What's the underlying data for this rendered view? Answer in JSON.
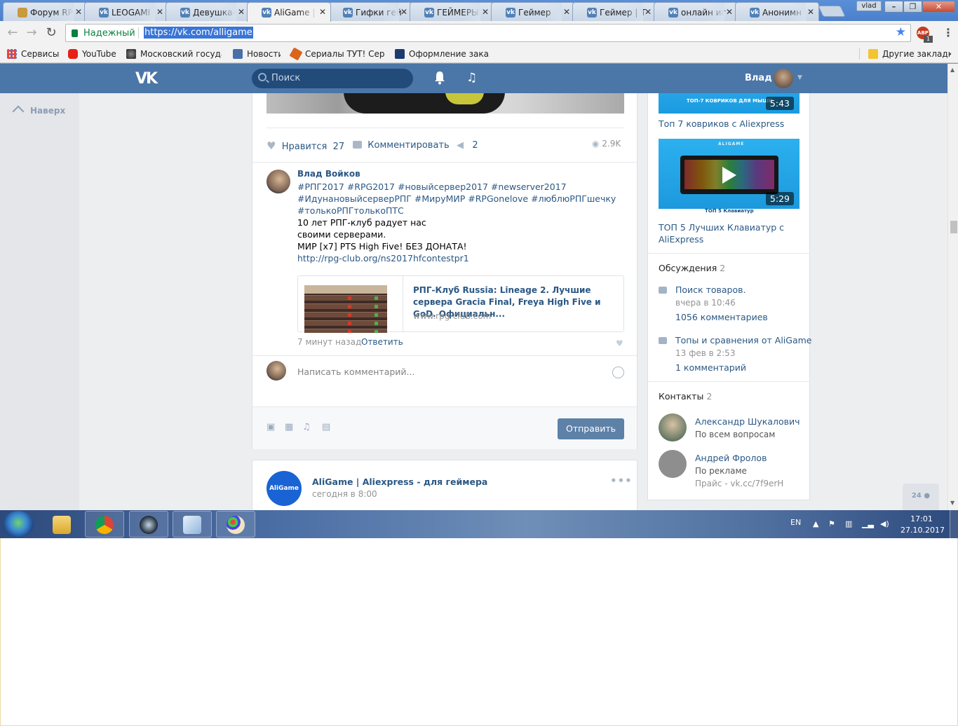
{
  "browser": {
    "tabs": [
      {
        "title": "Форум RP",
        "fav": "coat-of-arms-icon"
      },
      {
        "title": "LEOGAMI",
        "fav": "vk-icon"
      },
      {
        "title": "Девушка-",
        "fav": "vk-icon"
      },
      {
        "title": "AliGame |",
        "fav": "vk-icon",
        "active": true
      },
      {
        "title": "Гифки гей",
        "fav": "vk-icon"
      },
      {
        "title": "ГЕЙМЕРЫ",
        "fav": "vk-icon"
      },
      {
        "title": "Геймер",
        "fav": "vk-icon"
      },
      {
        "title": "Геймер | Т",
        "fav": "vk-icon"
      },
      {
        "title": "онлайн иг",
        "fav": "vk-icon"
      },
      {
        "title": "Анонимн",
        "fav": "vk-icon"
      }
    ],
    "profile_badge": "vlad",
    "secure_label": "Надежный",
    "url": "https://vk.com/alligame",
    "adblock_badge": "ABP",
    "adblock_count": "1",
    "bookmarks": [
      {
        "label": "Сервисы",
        "icon": "apps-grid-icon",
        "color": "#e8453c"
      },
      {
        "label": "YouTube",
        "icon": "youtube-icon",
        "color": "#e62117"
      },
      {
        "label": "Московский государ",
        "icon": "emblem-icon",
        "color": "#444444"
      },
      {
        "label": "Новости",
        "icon": "news-icon",
        "color": "#4a6ea9"
      },
      {
        "label": "Сериалы ТУТ! Сериа",
        "icon": "serials-icon",
        "color": "#d9641a"
      },
      {
        "label": "Оформление заказа",
        "icon": "sp-icon",
        "color": "#1c3a6e"
      },
      {
        "label": "Другие закладки",
        "icon": "folder-icon",
        "color": "#f4c430"
      }
    ],
    "win_controls": [
      "–",
      "❐",
      "✕"
    ]
  },
  "vk": {
    "search_placeholder": "Поиск",
    "user_name": "Влад",
    "back_up": "Наверх",
    "post": {
      "like_label": "Нравится",
      "like_count": "27",
      "comment_label": "Комментировать",
      "share_count": "2",
      "views": "2.9K",
      "comment": {
        "author": "Влад Войков",
        "lines": [
          "#РПГ2017 #RPG2017 #новыйсервер2017 #newserver2017",
          "#ИдунановыйсерверРПГ #МируМИР #RPGonelove #люблюРПГшечку",
          "#толькоРПГтолькоПТС",
          "10 лет РПГ-клуб радует нас",
          "своими серверами.",
          "МИР [x7] PTS High Five! БЕЗ ДОНАТА!",
          "http://rpg-club.org/ns2017hfcontestpr1"
        ],
        "link_title": "РПГ-Клуб Russia: Lineage 2. Лучшие сервера Gracia Final, Freya High Five и GoD. Официальн...",
        "link_domain": "www.rpg-club.com",
        "link_thumb_header": "Сравнение Зон в PTS платформ",
        "time": "7 минут назад",
        "reply": "Ответить"
      },
      "write_placeholder": "Написать комментарий...",
      "send_label": "Отправить"
    },
    "post2": {
      "avatar_text": "AliGame",
      "name": "AliGame | Aliexpress - для геймера",
      "time": "сегодня в 8:00",
      "more": "•••"
    },
    "side": {
      "videos": [
        {
          "caption": "ТОП-7 КОВРИКОВ ДЛЯ МЫШИ",
          "duration": "5:43",
          "title": "Топ 7 ковриков с Aliexpress"
        },
        {
          "brand": "ALIGAME",
          "caption": "ТОП 5 Клавиатур",
          "duration": "5:29",
          "title_l1": "ТОП 5 Лучших Клавиатур с",
          "title_l2": "AliExpress"
        }
      ],
      "discussions_title": "Обсуждения",
      "discussions_count": "2",
      "discussions": [
        {
          "title": "Поиск товаров.",
          "meta": "вчера в 10:46",
          "count": "1056 комментариев"
        },
        {
          "title": "Топы и сравнения от AliGame",
          "meta": "13 фев в 2:53",
          "count": "1 комментарий"
        }
      ],
      "contacts_title": "Контакты",
      "contacts_count": "2",
      "contacts": [
        {
          "name": "Александр Шукалович",
          "role": "По всем вопросам",
          "extra": ""
        },
        {
          "name": "Андрей Фролов",
          "role": "По рекламе",
          "extra": "Прайс - vk.cc/7f9erH"
        }
      ]
    },
    "online_count": "24"
  },
  "taskbar": {
    "lang": "EN",
    "time": "17:01",
    "date": "27.10.2017"
  }
}
